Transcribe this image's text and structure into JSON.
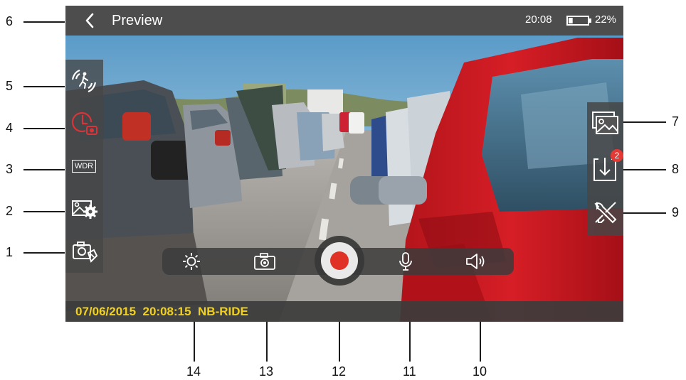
{
  "header": {
    "back_icon": "chevron-left-icon",
    "title": "Preview",
    "time": "20:08",
    "battery_percent": "22%",
    "battery_level": 0.22
  },
  "overlay": {
    "timestamp": "07/06/2015  20:08:15  NB-RIDE",
    "timestamp_color": "#f2d11d"
  },
  "left_icons": [
    {
      "callout": "5",
      "icon": "motion-detection-icon"
    },
    {
      "callout": "4",
      "icon": "time-lapse-icon"
    },
    {
      "callout": "3",
      "icon": "wdr-icon",
      "label": "WDR"
    },
    {
      "callout": "2",
      "icon": "image-settings-icon"
    },
    {
      "callout": "1",
      "icon": "camera-mode-icon"
    }
  ],
  "right_icons": [
    {
      "callout": "7",
      "icon": "gallery-icon"
    },
    {
      "callout": "8",
      "icon": "download-icon",
      "badge": "2"
    },
    {
      "callout": "9",
      "icon": "settings-tools-icon"
    }
  ],
  "controls": [
    {
      "callout": "14",
      "icon": "brightness-icon"
    },
    {
      "callout": "13",
      "icon": "snapshot-camera-icon"
    },
    {
      "callout": "12",
      "icon": "record-button"
    },
    {
      "callout": "11",
      "icon": "microphone-icon"
    },
    {
      "callout": "10",
      "icon": "speaker-icon"
    }
  ],
  "top_callout": "6",
  "colors": {
    "record": "#e03126",
    "badge": "#e53935",
    "accent_red_icon": "#d8343a"
  }
}
